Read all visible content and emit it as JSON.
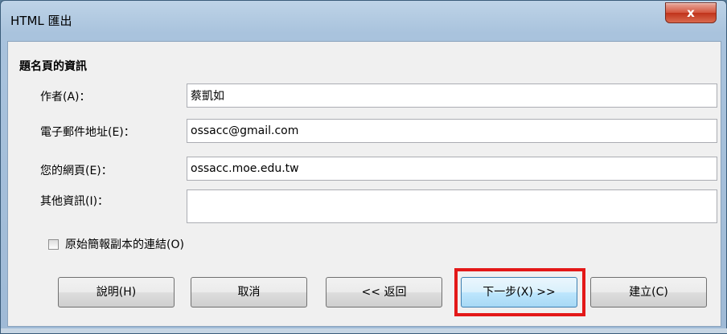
{
  "window": {
    "title": "HTML 匯出",
    "close_label": "x"
  },
  "section": {
    "title": "題名頁的資訊"
  },
  "fields": {
    "author": {
      "label": "作者(A)：",
      "value": "蔡凱如"
    },
    "email": {
      "label": "電子郵件地址(E)：",
      "value": "ossacc@gmail.com"
    },
    "homepage": {
      "label": "您的網頁(E)：",
      "value": "ossacc.moe.edu.tw"
    },
    "other": {
      "label": "其他資訊(I)：",
      "value": ""
    }
  },
  "checkbox": {
    "label": "原始簡報副本的連結(O)",
    "checked": false
  },
  "buttons": {
    "help": "說明(H)",
    "cancel": "取消",
    "back": "<< 返回",
    "next": "下一步(X) >>",
    "create": "建立(C)"
  },
  "colors": {
    "highlight": "#e31818",
    "close_button": "#c0331b"
  }
}
